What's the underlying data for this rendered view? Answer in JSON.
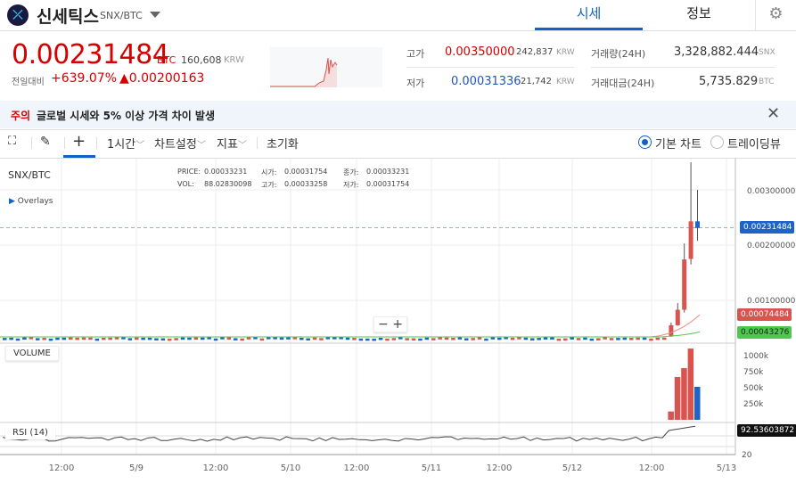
{
  "header": {
    "coin_name": "신세틱스",
    "pair": "SNX/BTC",
    "tabs": [
      "시세",
      "정보"
    ]
  },
  "ticker": {
    "price": "0.00231484",
    "price_unit": "BTC",
    "krw_price": "160,608",
    "krw_unit": "KRW",
    "change_label": "전일대비",
    "change_pct": "+639.07%",
    "change_abs": "▲0.00200163",
    "high_label": "고가",
    "high": "0.00350000",
    "high_krw": "242,837",
    "low_label": "저가",
    "low": "0.00031336",
    "low_krw": "21,742",
    "vol_label": "거래량(24H)",
    "vol": "3,328,882.444",
    "vol_unit": "SNX",
    "amt_label": "거래대금(24H)",
    "amt": "5,735.829",
    "amt_unit": "BTC"
  },
  "notice": {
    "tag": "주의",
    "text": "글로벌 시세와 5% 이상 가격 차이 발생"
  },
  "toolbar": {
    "interval": "1시간",
    "chart_settings": "차트설정",
    "indicators": "지표",
    "reset": "초기화",
    "radio_basic": "기본 차트",
    "radio_tv": "트레이딩뷰"
  },
  "legend": {
    "symbol": "SNX/BTC",
    "overlays": "Overlays",
    "price_l": "PRICE:",
    "price": "0.00033231",
    "open_l": "시가:",
    "open": "0.00031754",
    "close_l": "종가:",
    "close": "0.00033231",
    "vol_l": "VOL:",
    "vol": "88.02830098",
    "high_l": "고가:",
    "high": "0.00033258",
    "low_l": "저가:",
    "low": "0.00031754"
  },
  "panels": {
    "volume": "VOLUME",
    "rsi": "RSI (14)"
  },
  "colors": {
    "up": "#d9534f",
    "down": "#1e64c8",
    "accent": "#1261c4",
    "ma_green": "#4cc94c"
  },
  "chart_data": {
    "type": "candlestick",
    "price_ticks": [
      "0.00300000",
      "0.00200000",
      "0.00100000"
    ],
    "price_tick_values": [
      0.003,
      0.002,
      0.001
    ],
    "last_price_tag": "0.00231484",
    "ma1_tag": "0.00074484",
    "ma2_tag": "0.00043276",
    "rsi_tag": "92.53603872",
    "volume_ticks": [
      "1000k",
      "750k",
      "500k",
      "250k"
    ],
    "volume_tick_values": [
      1000000,
      750000,
      500000,
      250000
    ],
    "rsi_ticks": [
      "20"
    ],
    "x_ticks": [
      "12:00",
      "5/9",
      "12:00",
      "5/10",
      "12:00",
      "5/11",
      "12:00",
      "5/12",
      "12:00",
      "5/13"
    ],
    "flat_level": 0.0003,
    "last_candles": [
      {
        "o": 0.00035,
        "h": 0.0006,
        "l": 0.00034,
        "c": 0.00055,
        "v": 130000
      },
      {
        "o": 0.00055,
        "h": 0.00095,
        "l": 0.00054,
        "c": 0.00083,
        "v": 667000
      },
      {
        "o": 0.00083,
        "h": 0.00203,
        "l": 0.00078,
        "c": 0.00174,
        "v": 805000
      },
      {
        "o": 0.00175,
        "h": 0.0035,
        "l": 0.00165,
        "c": 0.00243,
        "v": 1110000
      },
      {
        "o": 0.00243,
        "h": 0.003,
        "l": 0.00208,
        "c": 0.00231,
        "v": 514000
      }
    ]
  }
}
